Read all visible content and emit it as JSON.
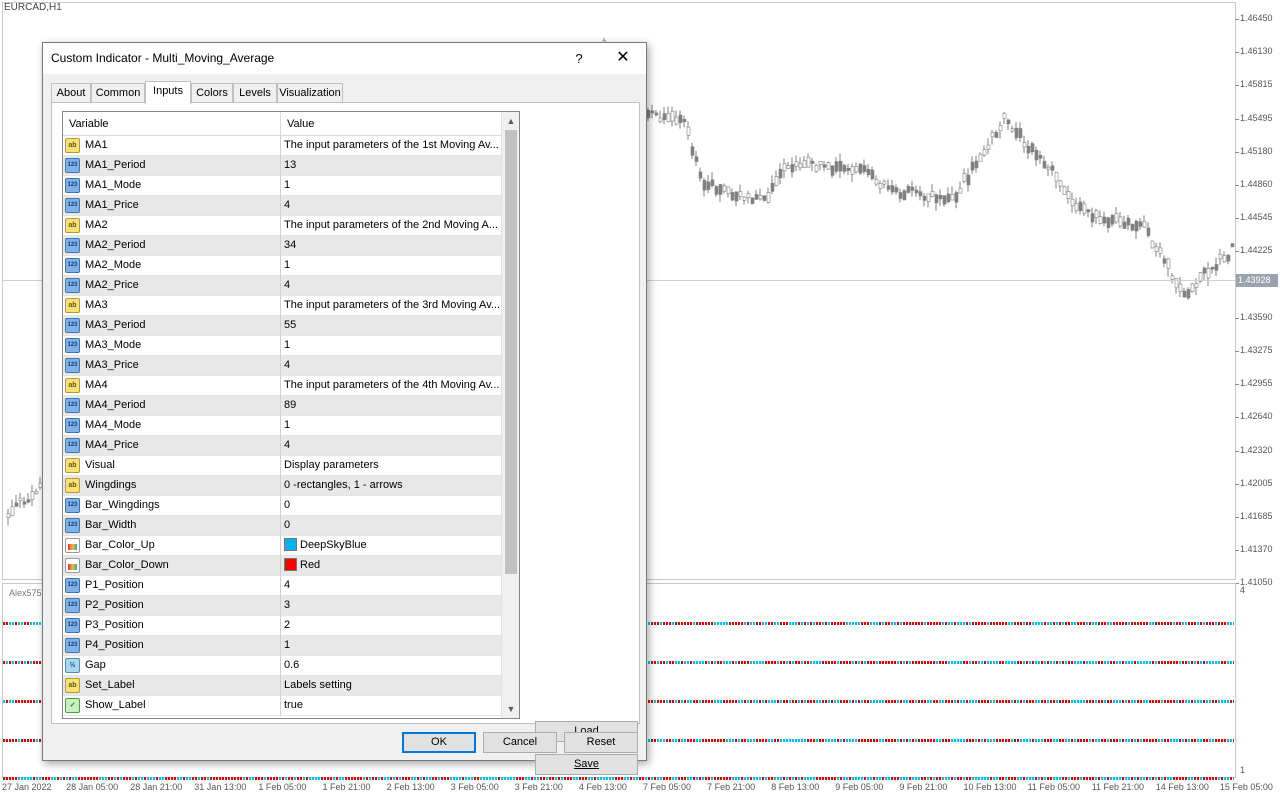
{
  "chart": {
    "symbol": "EURCAD,H1",
    "price_ticks": [
      "1.46450",
      "1.46130",
      "1.45815",
      "1.45495",
      "1.45180",
      "1.44860",
      "1.44545",
      "1.44225",
      "1.43590",
      "1.43275",
      "1.42955",
      "1.42640",
      "1.42320",
      "1.42005",
      "1.41685",
      "1.41370",
      "1.41050"
    ],
    "current_price": "1.43928",
    "sub_window_label": "Alex5757",
    "sub_axis_top": "4",
    "sub_axis_bottom": "1",
    "time_ticks": [
      "27 Jan 2022",
      "28 Jan 05:00",
      "28 Jan 21:00",
      "31 Jan 13:00",
      "1 Feb 05:00",
      "1 Feb 21:00",
      "2 Feb 13:00",
      "3 Feb 05:00",
      "3 Feb 21:00",
      "4 Feb 13:00",
      "7 Feb 05:00",
      "7 Feb 21:00",
      "8 Feb 13:00",
      "9 Feb 05:00",
      "9 Feb 21:00",
      "10 Feb 13:00",
      "11 Feb 05:00",
      "11 Feb 21:00",
      "14 Feb 13:00",
      "15 Feb 05:00"
    ],
    "colors": {
      "up": "#00bfff",
      "down": "#e00000",
      "candle": "#808080"
    }
  },
  "dialog": {
    "title": "Custom Indicator - Multi_Moving_Average",
    "help": "?",
    "close": "✕",
    "tabs": [
      "About",
      "Common",
      "Inputs",
      "Colors",
      "Levels",
      "Visualization"
    ],
    "active_tab": "Inputs",
    "grid": {
      "header_variable": "Variable",
      "header_value": "Value",
      "rows": [
        {
          "icon": "ab",
          "var": "MA1",
          "val": "The input parameters of the 1st Moving Av..."
        },
        {
          "icon": "123",
          "var": "MA1_Period",
          "val": "13"
        },
        {
          "icon": "123",
          "var": "MA1_Mode",
          "val": "1"
        },
        {
          "icon": "123",
          "var": "MA1_Price",
          "val": "4"
        },
        {
          "icon": "ab",
          "var": "MA2",
          "val": "The input parameters of the 2nd Moving A..."
        },
        {
          "icon": "123",
          "var": "MA2_Period",
          "val": "34"
        },
        {
          "icon": "123",
          "var": "MA2_Mode",
          "val": "1"
        },
        {
          "icon": "123",
          "var": "MA2_Price",
          "val": "4"
        },
        {
          "icon": "ab",
          "var": "MA3",
          "val": "The input parameters of the 3rd Moving Av..."
        },
        {
          "icon": "123",
          "var": "MA3_Period",
          "val": "55"
        },
        {
          "icon": "123",
          "var": "MA3_Mode",
          "val": "1"
        },
        {
          "icon": "123",
          "var": "MA3_Price",
          "val": "4"
        },
        {
          "icon": "ab",
          "var": "MA4",
          "val": "The input parameters of the 4th Moving Av..."
        },
        {
          "icon": "123",
          "var": "MA4_Period",
          "val": "89"
        },
        {
          "icon": "123",
          "var": "MA4_Mode",
          "val": "1"
        },
        {
          "icon": "123",
          "var": "MA4_Price",
          "val": "4"
        },
        {
          "icon": "ab",
          "var": "Visual",
          "val": "Display parameters"
        },
        {
          "icon": "ab",
          "var": "Wingdings",
          "val": "0 -rectangles, 1 - arrows"
        },
        {
          "icon": "123",
          "var": "Bar_Wingdings",
          "val": "0"
        },
        {
          "icon": "123",
          "var": "Bar_Width",
          "val": "0"
        },
        {
          "icon": "color",
          "var": "Bar_Color_Up",
          "val": "DeepSkyBlue",
          "swatch": "#00b4ef"
        },
        {
          "icon": "color",
          "var": "Bar_Color_Down",
          "val": "Red",
          "swatch": "#ff0000"
        },
        {
          "icon": "123",
          "var": "P1_Position",
          "val": "4"
        },
        {
          "icon": "123",
          "var": "P2_Position",
          "val": "3"
        },
        {
          "icon": "123",
          "var": "P3_Position",
          "val": "2"
        },
        {
          "icon": "123",
          "var": "P4_Position",
          "val": "1"
        },
        {
          "icon": "dbl",
          "var": "Gap",
          "val": "0.6"
        },
        {
          "icon": "ab",
          "var": "Set_Label",
          "val": "Labels setting"
        },
        {
          "icon": "bool",
          "var": "Show_Label",
          "val": "true"
        }
      ]
    },
    "buttons": {
      "load": "Load",
      "save": "Save",
      "ok": "OK",
      "cancel": "Cancel",
      "reset": "Reset"
    }
  }
}
